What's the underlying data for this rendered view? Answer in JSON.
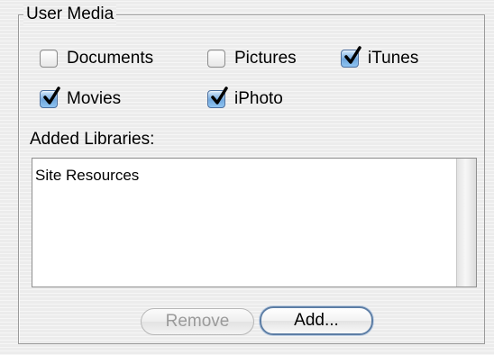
{
  "user_media": {
    "title": "User Media",
    "checkboxes": [
      {
        "label": "Documents",
        "checked": false
      },
      {
        "label": "Pictures",
        "checked": false
      },
      {
        "label": "iTunes",
        "checked": true
      },
      {
        "label": "Movies",
        "checked": true
      },
      {
        "label": "iPhoto",
        "checked": true
      }
    ],
    "added_libraries_label": "Added Libraries:",
    "libraries": [
      "Site Resources"
    ],
    "buttons": {
      "remove_label": "Remove",
      "add_label": "Add..."
    }
  }
}
